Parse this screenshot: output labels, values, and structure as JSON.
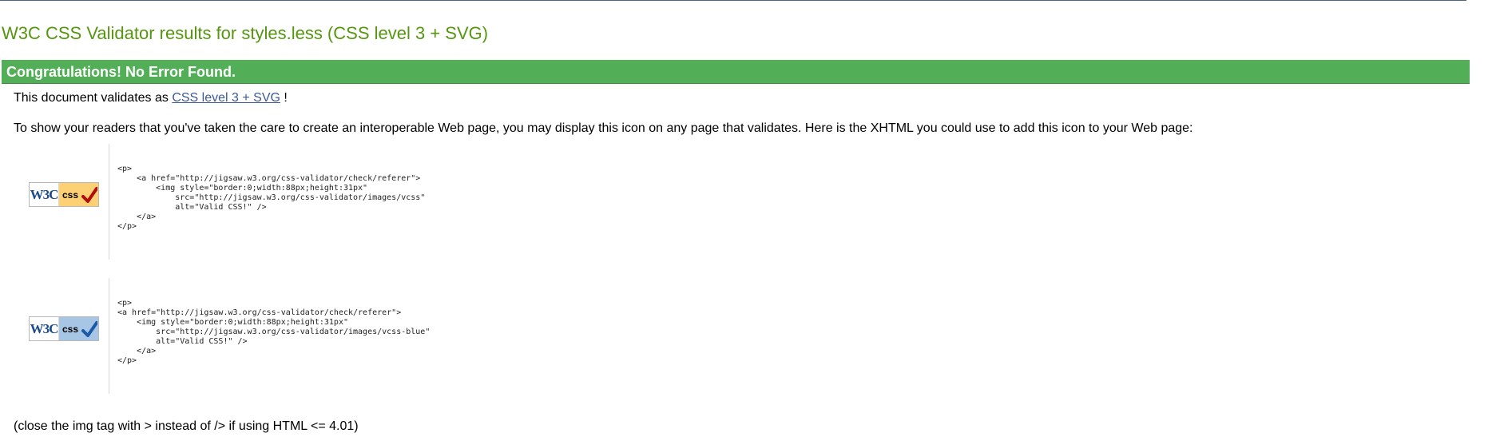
{
  "page": {
    "title": "W3C CSS Validator results for styles.less (CSS level 3 + SVG)"
  },
  "congrats": {
    "heading": "Congratulations! No Error Found."
  },
  "validates": {
    "prefix": "This document validates as ",
    "link_text": "CSS level 3 + SVG",
    "suffix": " !"
  },
  "info": {
    "text": "To show your readers that you've taken the care to create an interoperable Web page, you may display this icon on any page that validates. Here is the XHTML you could use to add this icon to your Web page:"
  },
  "badges": [
    {
      "w3c_text": "W3C",
      "css_text": "css",
      "style": "gold",
      "check_color": "#b10d0d",
      "code": "<p>\n    <a href=\"http://jigsaw.w3.org/css-validator/check/referer\">\n        <img style=\"border:0;width:88px;height:31px\"\n            src=\"http://jigsaw.w3.org/css-validator/images/vcss\"\n            alt=\"Valid CSS!\" />\n    </a>\n</p>"
    },
    {
      "w3c_text": "W3C",
      "css_text": "css",
      "style": "blue",
      "check_color": "#1c5aa8",
      "code": "<p>\n<a href=\"http://jigsaw.w3.org/css-validator/check/referer\">\n    <img style=\"border:0;width:88px;height:31px\"\n        src=\"http://jigsaw.w3.org/css-validator/images/vcss-blue\"\n        alt=\"Valid CSS!\" />\n    </a>\n</p>"
    }
  ],
  "footnote": {
    "text": "(close the img tag with > instead of /> if using HTML <= 4.01)"
  },
  "colors": {
    "title": "#55960f",
    "congrats_bar": "#52af57",
    "link": "#3b5998"
  }
}
